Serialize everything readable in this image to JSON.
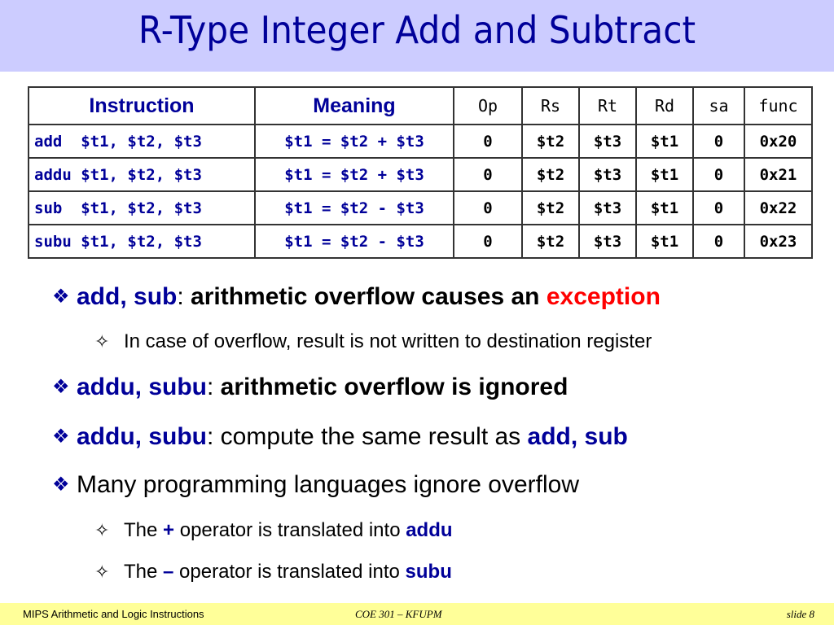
{
  "title": "R-Type Integer Add and Subtract",
  "table": {
    "headers": [
      "Instruction",
      "Meaning",
      "Op",
      "Rs",
      "Rt",
      "Rd",
      "sa",
      "func"
    ],
    "rows": [
      {
        "instruction": "add  $t1, $t2, $t3",
        "meaning": "$t1 = $t2 + $t3",
        "op": "0",
        "rs": "$t2",
        "rt": "$t3",
        "rd": "$t1",
        "sa": "0",
        "func": "0x20"
      },
      {
        "instruction": "addu $t1, $t2, $t3",
        "meaning": "$t1 = $t2 + $t3",
        "op": "0",
        "rs": "$t2",
        "rt": "$t3",
        "rd": "$t1",
        "sa": "0",
        "func": "0x21"
      },
      {
        "instruction": "sub  $t1, $t2, $t3",
        "meaning": "$t1 = $t2 - $t3",
        "op": "0",
        "rs": "$t2",
        "rt": "$t3",
        "rd": "$t1",
        "sa": "0",
        "func": "0x22"
      },
      {
        "instruction": "subu $t1, $t2, $t3",
        "meaning": "$t1 = $t2 - $t3",
        "op": "0",
        "rs": "$t2",
        "rt": "$t3",
        "rd": "$t1",
        "sa": "0",
        "func": "0x23"
      }
    ]
  },
  "bullets": {
    "b1": {
      "kw": "add, sub",
      "sep": ": ",
      "text": "arithmetic overflow causes an ",
      "highlight": "exception"
    },
    "b1_sub": {
      "text": "In case of overflow, result is not written to destination register"
    },
    "b2": {
      "kw": "addu, subu",
      "sep": ": ",
      "text": "arithmetic overflow is ignored"
    },
    "b3": {
      "kw": "addu, subu",
      "sep": ": ",
      "text": "compute the same result as ",
      "kw2": "add, sub"
    },
    "b4": {
      "text": "Many programming languages ignore overflow"
    },
    "b4_sub1": {
      "pre": "The ",
      "op": "+",
      "text": " operator is translated into ",
      "kw": "addu"
    },
    "b4_sub2": {
      "pre": "The ",
      "op": "–",
      "text": " operator is translated into ",
      "kw": "subu"
    },
    "diamond_glyph": "❖",
    "star_glyph": "✧"
  },
  "footer": {
    "left": "MIPS Arithmetic and Logic Instructions",
    "center": "COE 301 – KFUPM",
    "right": "slide 8"
  },
  "colors": {
    "title_bg": "#ccccff",
    "title_text": "#000099",
    "keyword": "#000099",
    "exception": "#ff0000",
    "footer_bg": "#ffff99"
  }
}
